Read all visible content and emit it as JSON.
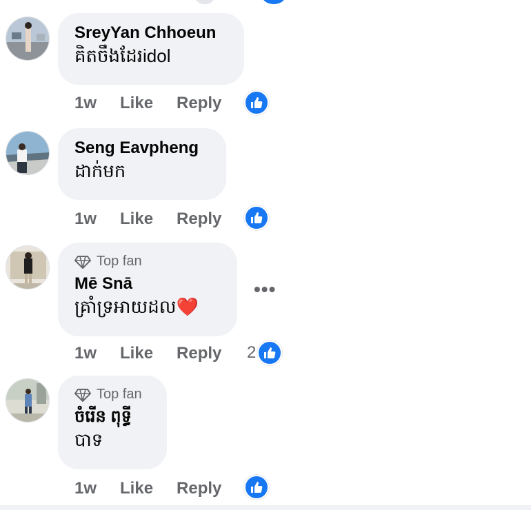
{
  "comments": [
    {
      "author": "SreyYan Chhoeun",
      "text": "គិតចឹងដែរidol",
      "time": "1w",
      "like_label": "Like",
      "reply_label": "Reply",
      "top_fan": false
    },
    {
      "author": "Seng Eavpheng",
      "text": "ដាក់មក",
      "time": "1w",
      "like_label": "Like",
      "reply_label": "Reply",
      "top_fan": false
    },
    {
      "author": "Mē Snā",
      "text": "គ្រាំទ្រអាយដល❤️",
      "time": "1w",
      "like_label": "Like",
      "reply_label": "Reply",
      "top_fan": true,
      "badge_label": "Top fan",
      "reaction_count": "2",
      "more_label": "•••"
    },
    {
      "author": "ចំរើន ពុទ្ធី",
      "text": "បាទ",
      "time": "1w",
      "like_label": "Like",
      "reply_label": "Reply",
      "top_fan": true,
      "badge_label": "Top fan"
    }
  ],
  "colors": {
    "accent": "#1877f2",
    "bubble": "#f0f2f5",
    "meta": "#65676b"
  },
  "icons": {
    "reaction": "thumbs-up-icon",
    "badge": "diamond-icon",
    "more": "more-icon"
  }
}
